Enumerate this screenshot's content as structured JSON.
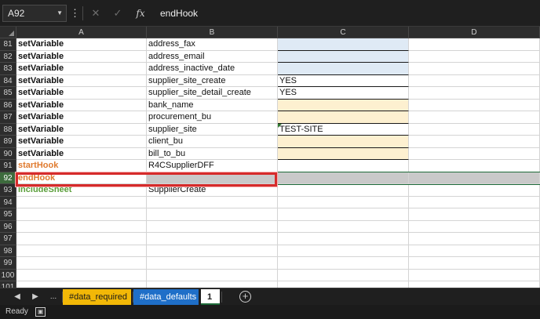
{
  "formula_bar": {
    "name_box": "A92",
    "more_icon": "⋮",
    "cancel_icon": "✕",
    "enter_icon": "✓",
    "fx_icon": "fx",
    "content": "endHook"
  },
  "columns": [
    "A",
    "B",
    "C",
    "D"
  ],
  "rows": [
    {
      "num": "81",
      "a": "setVariable",
      "b": "address_fax",
      "c": ""
    },
    {
      "num": "82",
      "a": "setVariable",
      "b": "address_email",
      "c": ""
    },
    {
      "num": "83",
      "a": "setVariable",
      "b": "address_inactive_date",
      "c": ""
    },
    {
      "num": "84",
      "a": "setVariable",
      "b": "supplier_site_create",
      "c": "YES"
    },
    {
      "num": "85",
      "a": "setVariable",
      "b": "supplier_site_detail_create",
      "c": "YES"
    },
    {
      "num": "86",
      "a": "setVariable",
      "b": "bank_name",
      "c": ""
    },
    {
      "num": "87",
      "a": "setVariable",
      "b": "procurement_bu",
      "c": ""
    },
    {
      "num": "88",
      "a": "setVariable",
      "b": "supplier_site",
      "c": "TEST-SITE"
    },
    {
      "num": "89",
      "a": "setVariable",
      "b": "client_bu",
      "c": ""
    },
    {
      "num": "90",
      "a": "setVariable",
      "b": "bill_to_bu",
      "c": ""
    },
    {
      "num": "91",
      "a": "startHook",
      "b": "R4CSupplierDFF",
      "c": ""
    },
    {
      "num": "92",
      "a": "endHook",
      "b": "",
      "c": ""
    },
    {
      "num": "93",
      "a": "includeSheet",
      "b": "SupplierCreate",
      "c": ""
    },
    {
      "num": "94",
      "a": "",
      "b": "",
      "c": ""
    },
    {
      "num": "95",
      "a": "",
      "b": "",
      "c": ""
    },
    {
      "num": "96",
      "a": "",
      "b": "",
      "c": ""
    },
    {
      "num": "97",
      "a": "",
      "b": "",
      "c": ""
    },
    {
      "num": "98",
      "a": "",
      "b": "",
      "c": ""
    },
    {
      "num": "99",
      "a": "",
      "b": "",
      "c": ""
    },
    {
      "num": "100",
      "a": "",
      "b": "",
      "c": ""
    },
    {
      "num": "101",
      "a": "",
      "b": "",
      "c": ""
    }
  ],
  "sheet_tabs": {
    "nav_prev": "◀",
    "nav_next": "▶",
    "more": "...",
    "tabs": [
      {
        "label": "#data_required"
      },
      {
        "label": "#data_defaults"
      },
      {
        "label": "1"
      }
    ],
    "add_sheet": "+"
  },
  "status_bar": {
    "ready": "Ready",
    "accessibility_icon": "accessibility-icon"
  },
  "colors": {
    "command_orange": "#e07a2e",
    "command_green": "#5a9e3a",
    "tab_required": "#f2b807",
    "tab_defaults": "#1f6fc8",
    "selection_red": "#d62b2b"
  }
}
